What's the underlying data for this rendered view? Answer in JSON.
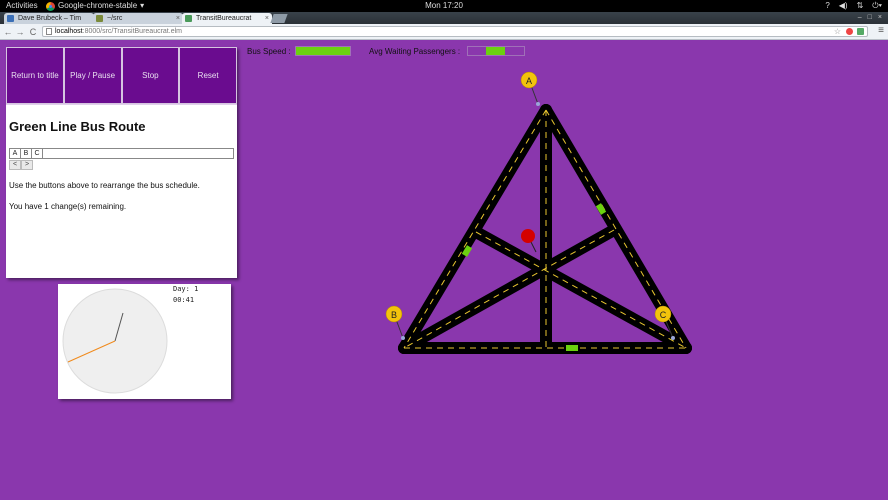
{
  "system_bar": {
    "activities": "Activities",
    "app_name": "Google-chrome-stable",
    "clock": "Mon 17:20"
  },
  "browser": {
    "tabs": [
      {
        "label": "Dave Brubeck – Tim"
      },
      {
        "label": "~/src"
      },
      {
        "label": "TransitBureaucrat"
      }
    ],
    "address": {
      "host": "localhost",
      "rest": ":8000/src/TransitBureaucrat.elm"
    }
  },
  "game": {
    "buttons": {
      "return": "Return to title",
      "play_pause": "Play / Pause",
      "stop": "Stop",
      "reset": "Reset"
    },
    "route_title": "Green Line Bus Route",
    "schedule": [
      "A",
      "B",
      "C"
    ],
    "arrows": {
      "left": "<",
      "right": ">"
    },
    "instructions": "Use the buttons above to rearrange the bus schedule.",
    "changes_text": "You have 1 change(s) remaining.",
    "clock": {
      "day": "Day: 1",
      "time": "00:41"
    },
    "meters": {
      "bus_speed_label": "Bus Speed :",
      "bus_speed_fraction": 1.0,
      "waiting_label": "Avg Waiting Passengers :",
      "waiting_fraction": 0.5
    },
    "stops": [
      {
        "letter": "A"
      },
      {
        "letter": "B"
      },
      {
        "letter": "C"
      }
    ],
    "colors": {
      "background": "#8a37ad",
      "button": "#6a0c8f",
      "bus": "#6bd10f",
      "stop_sign": "#f2c40c",
      "road": "#000000",
      "lane_marking": "#e8c630",
      "passenger": "#d40000",
      "clock_hand_hour": "#555555",
      "clock_hand_minute": "#f08a1c"
    }
  }
}
